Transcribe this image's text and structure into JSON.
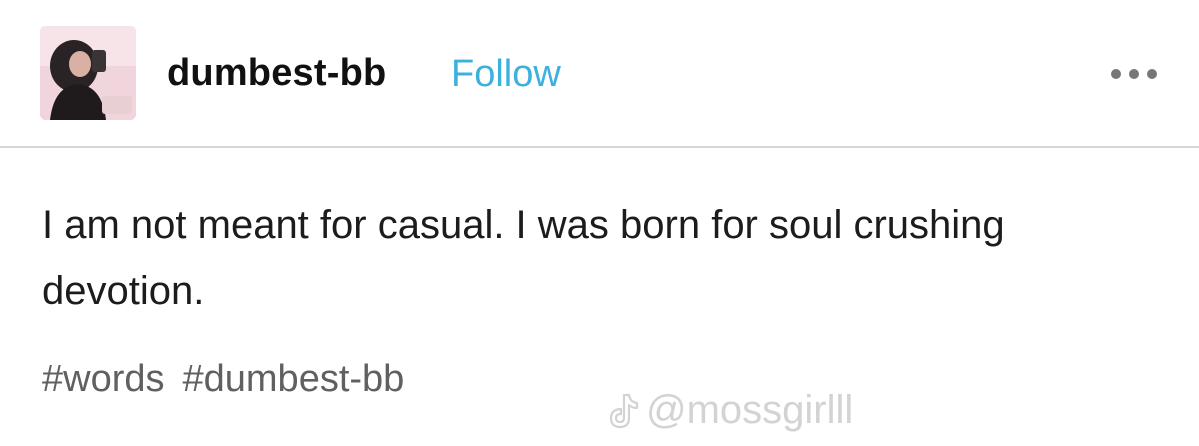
{
  "post": {
    "author": {
      "username": "dumbest-bb",
      "follow_label": "Follow"
    },
    "more_icon": "ellipsis-icon",
    "body": "I am not meant for casual. I was born for soul crushing devotion.",
    "tags": [
      "#words",
      "#dumbest-bb"
    ]
  },
  "watermark": {
    "icon": "tiktok-icon",
    "handle": "@mossgirlll"
  },
  "colors": {
    "follow_accent": "#3db1dd",
    "tag_text": "#606060",
    "divider": "#d6d6d6"
  }
}
